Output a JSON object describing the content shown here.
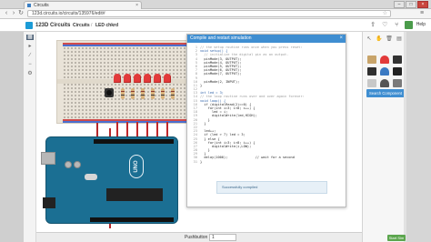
{
  "browser": {
    "tab_title": "Circuits",
    "tab_close": "×",
    "url": "123d.circuits.io/circuits/135976/edit#",
    "window_buttons": [
      "–",
      "□",
      "×"
    ]
  },
  "app": {
    "brand": "123D Circuits",
    "breadcrumb": [
      "Circuits",
      "LED chkrd"
    ],
    "breadcrumb_separator": "/",
    "help_label": "Help"
  },
  "rail": {
    "items": [
      "grid-icon",
      "pointer-icon",
      "wire-icon",
      "minus-icon",
      "settings-icon"
    ]
  },
  "editor": {
    "title": "Compile and restart simulation",
    "close": "×",
    "lines": [
      {
        "n": "1",
        "text": "// the setup routine runs once when you press reset:",
        "cls": "cm"
      },
      {
        "n": "2",
        "text": "void setup() {",
        "cls": "kw"
      },
      {
        "n": "3",
        "text": "  // initialize the digital pin as an output.",
        "cls": "cm"
      },
      {
        "n": "4",
        "text": "  pinMode(3, OUTPUT);",
        "cls": ""
      },
      {
        "n": "5",
        "text": "  pinMode(4, OUTPUT);",
        "cls": ""
      },
      {
        "n": "6",
        "text": "  pinMode(5, OUTPUT);",
        "cls": ""
      },
      {
        "n": "7",
        "text": "  pinMode(6, OUTPUT);",
        "cls": ""
      },
      {
        "n": "8",
        "text": "  pinMode(7, OUTPUT);",
        "cls": ""
      },
      {
        "n": "9",
        "text": "",
        "cls": ""
      },
      {
        "n": "10",
        "text": "  pinMode(2, INPUT);",
        "cls": ""
      },
      {
        "n": "11",
        "text": "}",
        "cls": ""
      },
      {
        "n": "12",
        "text": "",
        "cls": ""
      },
      {
        "n": "13",
        "text": "int led = 3;",
        "cls": "kw"
      },
      {
        "n": "14",
        "text": "// the loop routine runs over and over again forever:",
        "cls": "cm"
      },
      {
        "n": "15",
        "text": "void loop() {",
        "cls": "kw"
      },
      {
        "n": "16",
        "text": "  if (digitalRead(2)==0) {",
        "cls": ""
      },
      {
        "n": "17",
        "text": "    for(int i=3; i<8; i++) {",
        "cls": ""
      },
      {
        "n": "18",
        "text": "      led = i;",
        "cls": ""
      },
      {
        "n": "19",
        "text": "      digitalWrite(led,HIGH);",
        "cls": ""
      },
      {
        "n": "20",
        "text": "    }",
        "cls": ""
      },
      {
        "n": "21",
        "text": "  }",
        "cls": ""
      },
      {
        "n": "22",
        "text": "",
        "cls": ""
      },
      {
        "n": "23",
        "text": "  led++;",
        "cls": ""
      },
      {
        "n": "24",
        "text": "  if (led > 7) led = 3;",
        "cls": ""
      },
      {
        "n": "25",
        "text": "  } else {",
        "cls": ""
      },
      {
        "n": "26",
        "text": "    for(int i=3; i<8; i++) {",
        "cls": ""
      },
      {
        "n": "27",
        "text": "      digitalWrite(i,LOW);",
        "cls": ""
      },
      {
        "n": "28",
        "text": "    }",
        "cls": ""
      },
      {
        "n": "29",
        "text": "  }",
        "cls": ""
      },
      {
        "n": "30",
        "text": "  delay(1000);              // wait for a second",
        "cls": ""
      },
      {
        "n": "31",
        "text": "}",
        "cls": ""
      }
    ],
    "status": "Successfully compiled"
  },
  "sim_bar": {
    "label": "Pushbutton",
    "value": "1"
  },
  "components": {
    "search_button": "Search Component",
    "items": [
      "resistor-icon",
      "led-icon",
      "button-icon",
      "battery-icon",
      "potentiometer-icon",
      "ic-icon",
      "capacitor-icon",
      "transistor-icon",
      "motor-icon"
    ],
    "item_colors": [
      "#c8a46a",
      "#e23a3a",
      "#333333",
      "#2f2f2f",
      "#3a79c2",
      "#222222",
      "#c8c8c8",
      "#555555",
      "#7a7a7a"
    ]
  },
  "sidebar_status": "Start Sim",
  "colors": {
    "accent": "#3f8ed1",
    "wire": "#c0282b",
    "arduino": "#1b6f93",
    "breadboard": "#e9e3d8"
  },
  "arduino_label": "UNO"
}
